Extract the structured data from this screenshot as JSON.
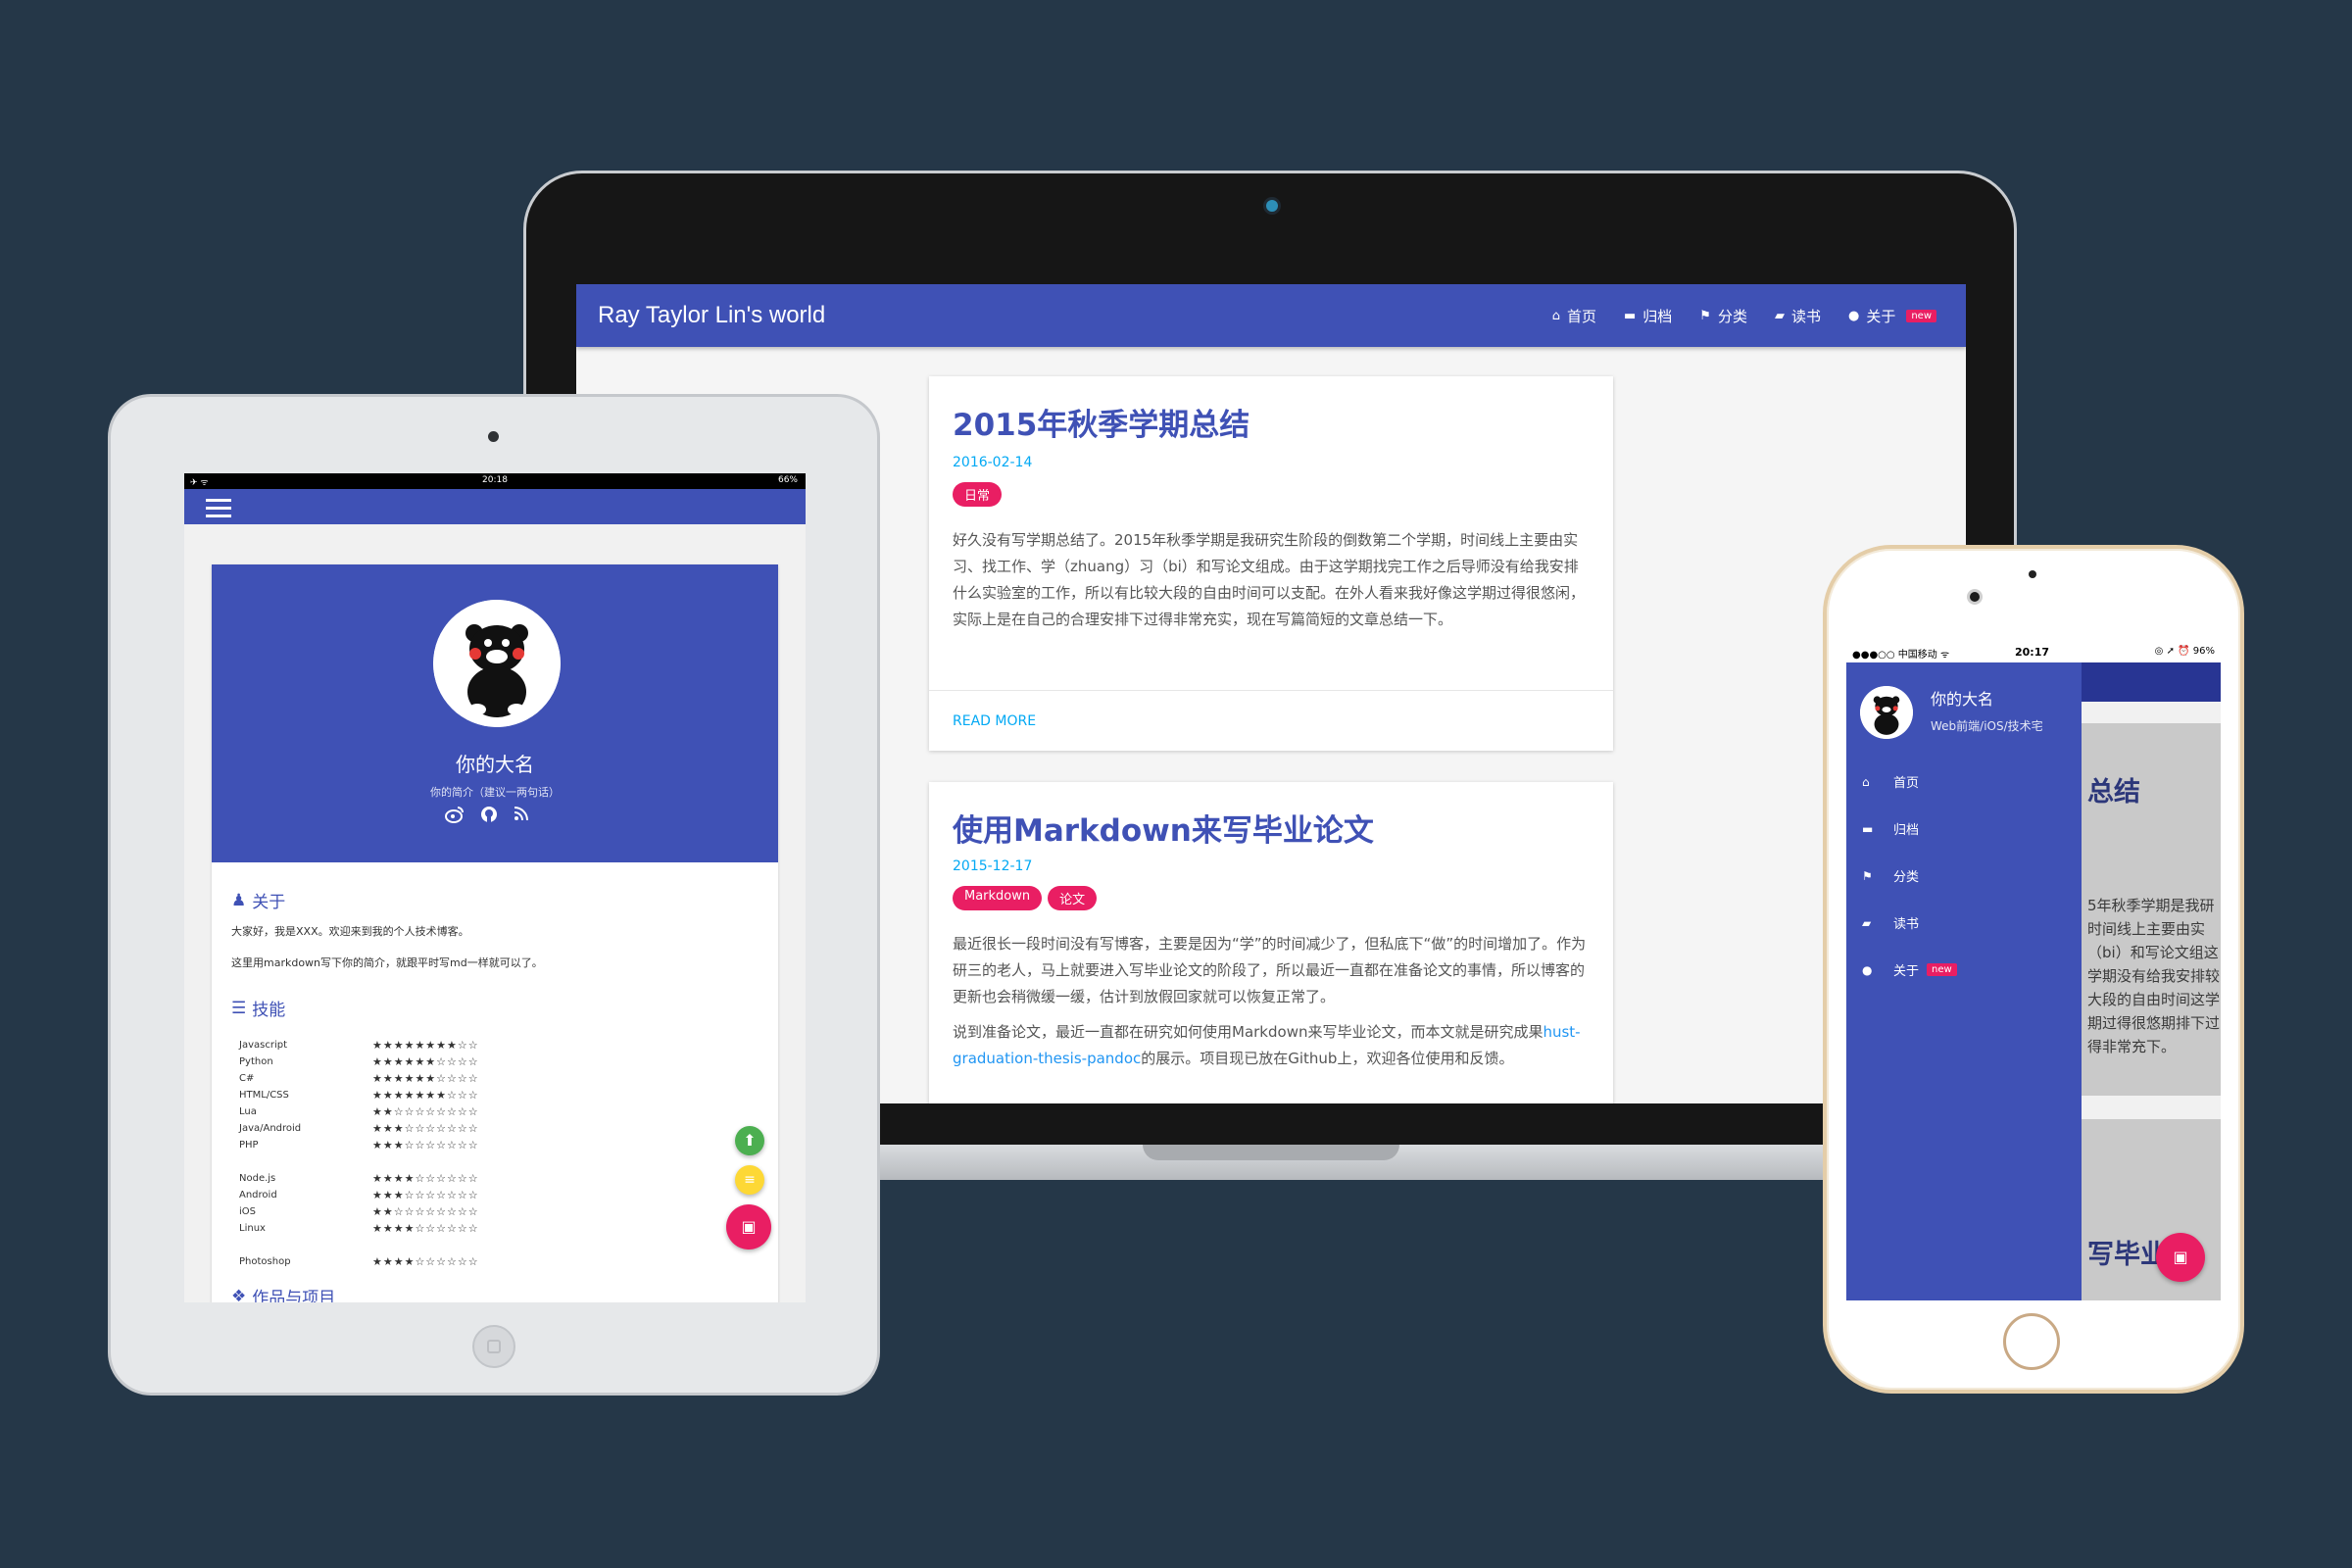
{
  "laptop": {
    "brand": "Ray Taylor Lin's world",
    "nav": [
      {
        "icon": "⌂",
        "label": "首页"
      },
      {
        "icon": "▬",
        "label": "归档"
      },
      {
        "icon": "⚑",
        "label": "分类"
      },
      {
        "icon": "▰",
        "label": "读书"
      },
      {
        "icon": "●",
        "label": "关于",
        "badge": "new"
      }
    ],
    "posts": [
      {
        "title": "2015年秋季学期总结",
        "date": "2016-02-14",
        "tags": [
          "日常"
        ],
        "excerpt": "好久没有写学期总结了。2015年秋季学期是我研究生阶段的倒数第二个学期，时间线上主要由实习、找工作、学（zhuang）习（bi）和写论文组成。由于这学期找完工作之后导师没有给我安排什么实验室的工作，所以有比较大段的自由时间可以支配。在外人看来我好像这学期过得很悠闲，实际上是在自己的合理安排下过得非常充实，现在写篇简短的文章总结一下。",
        "read_more": "READ MORE"
      },
      {
        "title": "使用Markdown来写毕业论文",
        "date": "2015-12-17",
        "tags": [
          "Markdown",
          "论文"
        ],
        "excerpt": "最近很长一段时间没有写博客，主要是因为“学”的时间减少了，但私底下“做”的时间增加了。作为研三的老人，马上就要进入写毕业论文的阶段了，所以最近一直都在准备论文的事情，所以博客的更新也会稍微缓一缓，估计到放假回家就可以恢复正常了。",
        "excerpt2_pre": "说到准备论文，最近一直都在研究如何使用Markdown来写毕业论文，而本文就是研究成果",
        "excerpt2_link": "hust-graduation-thesis-pandoc",
        "excerpt2_post": "的展示。项目现已放在Github上，欢迎各位使用和反馈。"
      }
    ]
  },
  "tablet": {
    "status": {
      "left": "✈ ᯤ",
      "time": "20:18",
      "battery": "66%"
    },
    "profile_name": "你的大名",
    "profile_bio": "你的简介（建议一两句话）",
    "social_icons": [
      "weibo-icon",
      "github-icon",
      "rss-icon"
    ],
    "about": {
      "heading": "关于",
      "line1": "大家好，我是XXX。欢迎来到我的个人技术博客。",
      "line2": "这里用markdown写下你的简介，就跟平时写md一样就可以了。"
    },
    "skills_heading": "技能",
    "skills": [
      {
        "name": "Javascript",
        "rating": "★★★★★★★★☆☆",
        "value": 8
      },
      {
        "name": "Python",
        "rating": "★★★★★★☆☆☆☆",
        "value": 6
      },
      {
        "name": "C#",
        "rating": "★★★★★★☆☆☆☆",
        "value": 6
      },
      {
        "name": "HTML/CSS",
        "rating": "★★★★★★★☆☆☆",
        "value": 7
      },
      {
        "name": "Lua",
        "rating": "★★☆☆☆☆☆☆☆☆",
        "value": 2
      },
      {
        "name": "Java/Android",
        "rating": "★★★☆☆☆☆☆☆☆",
        "value": 3
      },
      {
        "name": "PHP",
        "rating": "★★★☆☆☆☆☆☆☆",
        "value": 3
      },
      {
        "name": "",
        "rating": "",
        "gap": true
      },
      {
        "name": "Node.js",
        "rating": "★★★★☆☆☆☆☆☆",
        "value": 4
      },
      {
        "name": "Android",
        "rating": "★★★☆☆☆☆☆☆☆",
        "value": 3
      },
      {
        "name": "iOS",
        "rating": "★★☆☆☆☆☆☆☆☆",
        "value": 2
      },
      {
        "name": "Linux",
        "rating": "★★★★☆☆☆☆☆☆",
        "value": 4
      },
      {
        "name": "",
        "rating": "",
        "gap": true
      },
      {
        "name": "Photoshop",
        "rating": "★★★★☆☆☆☆☆☆",
        "value": 4
      }
    ],
    "projects_heading": "作品与项目",
    "colors": {
      "primary": "#3f51b5",
      "fab_green": "#4caf50",
      "fab_yellow": "#fdd835",
      "fab_pink": "#e91e63"
    }
  },
  "phone": {
    "status": {
      "carrier": "●●●○○ 中国移动 ᯤ",
      "time": "20:17",
      "right": "◎ ➚ ⏰ 96%"
    },
    "drawer_name": "你的大名",
    "drawer_bio": "Web前端/iOS/技术宅",
    "menu": [
      {
        "icon": "⌂",
        "label": "首页"
      },
      {
        "icon": "▬",
        "label": "归档"
      },
      {
        "icon": "⚑",
        "label": "分类"
      },
      {
        "icon": "▰",
        "label": "读书"
      },
      {
        "icon": "●",
        "label": "关于",
        "badge": "new"
      }
    ],
    "bg_title1": "总结",
    "bg_text": "5年秋季学期是我研时间线上主要由实（bi）和写论文组这学期没有给我安排较大段的自由时间这学期过得很悠期排下过得非常充下。",
    "bg_title2": "写毕业"
  }
}
